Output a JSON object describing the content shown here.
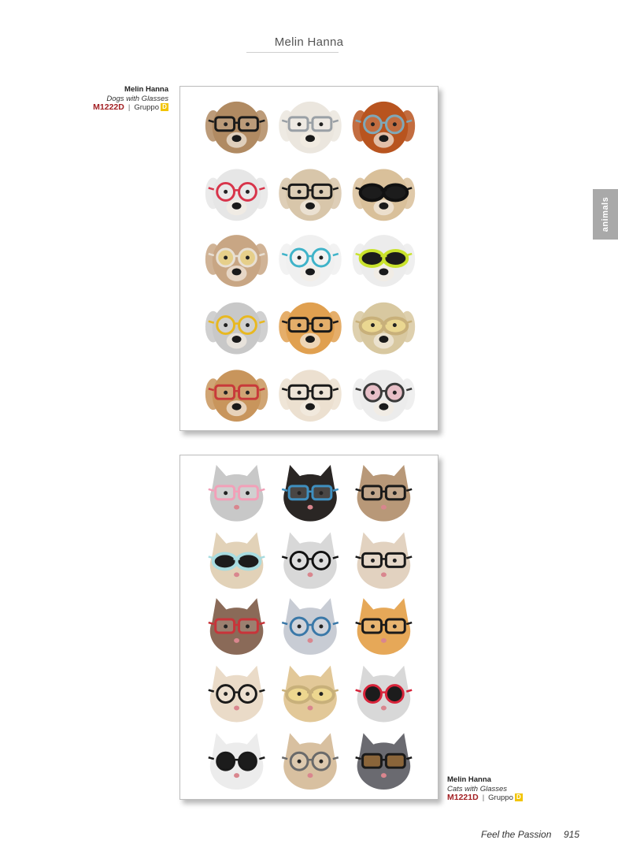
{
  "header": {
    "title": "Melin Hanna"
  },
  "side_tab": {
    "label": "animals"
  },
  "products": [
    {
      "artist": "Melin Hanna",
      "title": "Dogs with Glasses",
      "code": "M1222D",
      "separator": "|",
      "group_label": "Gruppo",
      "group_code": "D",
      "image_subject": "dogs",
      "faces": [
        {
          "face": "#b08a62",
          "glasses": "#1a1a1a",
          "lens": "none",
          "style": "square"
        },
        {
          "face": "#ebe6de",
          "glasses": "#9aa0a6",
          "lens": "none",
          "style": "held"
        },
        {
          "face": "#b8541f",
          "glasses": "#7fa8b8",
          "lens": "none",
          "style": "round"
        },
        {
          "face": "#e6e6e6",
          "glasses": "#d8344a",
          "lens": "none",
          "style": "round"
        },
        {
          "face": "#d8c6aa",
          "glasses": "#1a1a1a",
          "lens": "none",
          "style": "square"
        },
        {
          "face": "#d9c09a",
          "glasses": "#111111",
          "lens": "dark",
          "style": "aviator"
        },
        {
          "face": "#c8a684",
          "glasses": "#e8e0d4",
          "lens": "light",
          "style": "round"
        },
        {
          "face": "#f0f0f0",
          "glasses": "#3fb3c9",
          "lens": "none",
          "style": "round"
        },
        {
          "face": "#ececec",
          "glasses": "#c9e22c",
          "lens": "dark",
          "style": "goggle"
        },
        {
          "face": "#c8c8c8",
          "glasses": "#e8b820",
          "lens": "none",
          "style": "round"
        },
        {
          "face": "#e0a050",
          "glasses": "#1a1a1a",
          "lens": "none",
          "style": "square"
        },
        {
          "face": "#d8c8a0",
          "glasses": "#c8b07a",
          "lens": "light",
          "style": "aviator"
        },
        {
          "face": "#c8955c",
          "glasses": "#c83a3a",
          "lens": "none",
          "style": "square"
        },
        {
          "face": "#ece0d0",
          "glasses": "#1a1a1a",
          "lens": "none",
          "style": "square"
        },
        {
          "face": "#ececec",
          "glasses": "#3a3a3a",
          "lens": "pink",
          "style": "round"
        }
      ]
    },
    {
      "artist": "Melin Hanna",
      "title": "Cats with Glasses",
      "code": "M1221D",
      "separator": "|",
      "group_label": "Gruppo",
      "group_code": "D",
      "image_subject": "cats",
      "faces": [
        {
          "face": "#c8c8c8",
          "glasses": "#f2a0b8",
          "lens": "none",
          "style": "square"
        },
        {
          "face": "#2a2624",
          "glasses": "#3f8fbf",
          "lens": "none",
          "style": "square"
        },
        {
          "face": "#b89878",
          "glasses": "#1a1a1a",
          "lens": "none",
          "style": "square"
        },
        {
          "face": "#e2d2b8",
          "glasses": "#a8dce0",
          "lens": "dark",
          "style": "cateye"
        },
        {
          "face": "#d8d8d8",
          "glasses": "#111111",
          "lens": "none",
          "style": "round"
        },
        {
          "face": "#e2d2c0",
          "glasses": "#1a1a1a",
          "lens": "none",
          "style": "square"
        },
        {
          "face": "#8a6a58",
          "glasses": "#c8343a",
          "lens": "none",
          "style": "square"
        },
        {
          "face": "#c8ccd4",
          "glasses": "#3a78a8",
          "lens": "none",
          "style": "round"
        },
        {
          "face": "#e6a858",
          "glasses": "#1a1a1a",
          "lens": "none",
          "style": "square"
        },
        {
          "face": "#eadbc8",
          "glasses": "#1a1a1a",
          "lens": "none",
          "style": "round"
        },
        {
          "face": "#e2c898",
          "glasses": "#c8b07a",
          "lens": "light",
          "style": "aviator"
        },
        {
          "face": "#d8d8d8",
          "glasses": "#d8243a",
          "lens": "dark",
          "style": "heart"
        },
        {
          "face": "#ececec",
          "glasses": "#1a1a1a",
          "lens": "dark",
          "style": "round"
        },
        {
          "face": "#d8c0a0",
          "glasses": "#6a6a6a",
          "lens": "none",
          "style": "round"
        },
        {
          "face": "#6a6a70",
          "glasses": "#1a1a1a",
          "lens": "brown",
          "style": "square"
        }
      ]
    }
  ],
  "footer": {
    "slogan": "Feel the Passion",
    "page_number": "915"
  }
}
